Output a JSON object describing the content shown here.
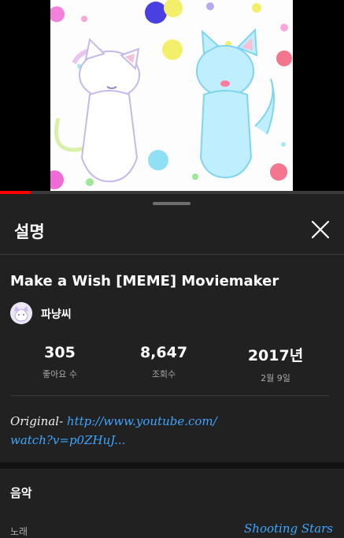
{
  "player": {
    "progress": 0.09,
    "thumbnail_icon": "cat-artwork-thumbnail",
    "accent_color": "#ff0000"
  },
  "sheet": {
    "title": "설명",
    "close_icon": "close-icon"
  },
  "video": {
    "title": "Make a Wish [MEME] Moviemaker",
    "channel_name": "파냥씨",
    "avatar_icon": "channel-avatar"
  },
  "stats": [
    {
      "value": "305",
      "label": "좋아요 수"
    },
    {
      "value": "8,647",
      "label": "조회수"
    },
    {
      "value": "2017년",
      "label": "2월 9일"
    }
  ],
  "description": {
    "prefix": "Original- ",
    "link_line1": "http://www.youtube.com/",
    "link_line2": "watch?v=p0ZHuJ..."
  },
  "music": {
    "heading": "음악",
    "song_label": "노래",
    "song_value": "Shooting Stars"
  },
  "colors": {
    "background": "#212121",
    "link": "#3ea6ff",
    "secondary_text": "#aaaaaa"
  }
}
